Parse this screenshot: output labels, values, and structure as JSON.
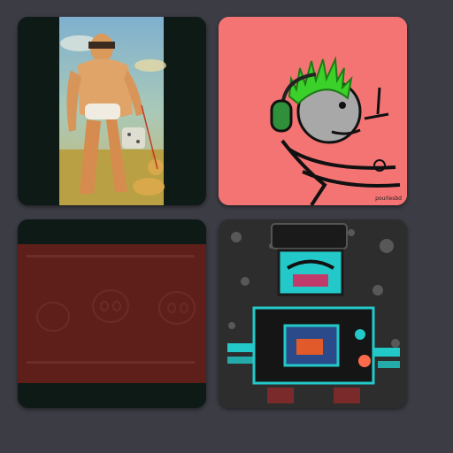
{
  "gallery": {
    "tiles": [
      {
        "name": "muscle-man-dog-painting"
      },
      {
        "name": "headphones-stick-figure-drawing",
        "signature": "pourlesbd"
      },
      {
        "name": "dark-red-skulls-image"
      },
      {
        "name": "neon-robot-drawing"
      }
    ]
  },
  "colors": {
    "background": "#3b3c44",
    "tile_dark": "#0e1a15",
    "salmon": "#f47474",
    "hair_green": "#3bd12a",
    "neon_cyan": "#23c9c9"
  }
}
